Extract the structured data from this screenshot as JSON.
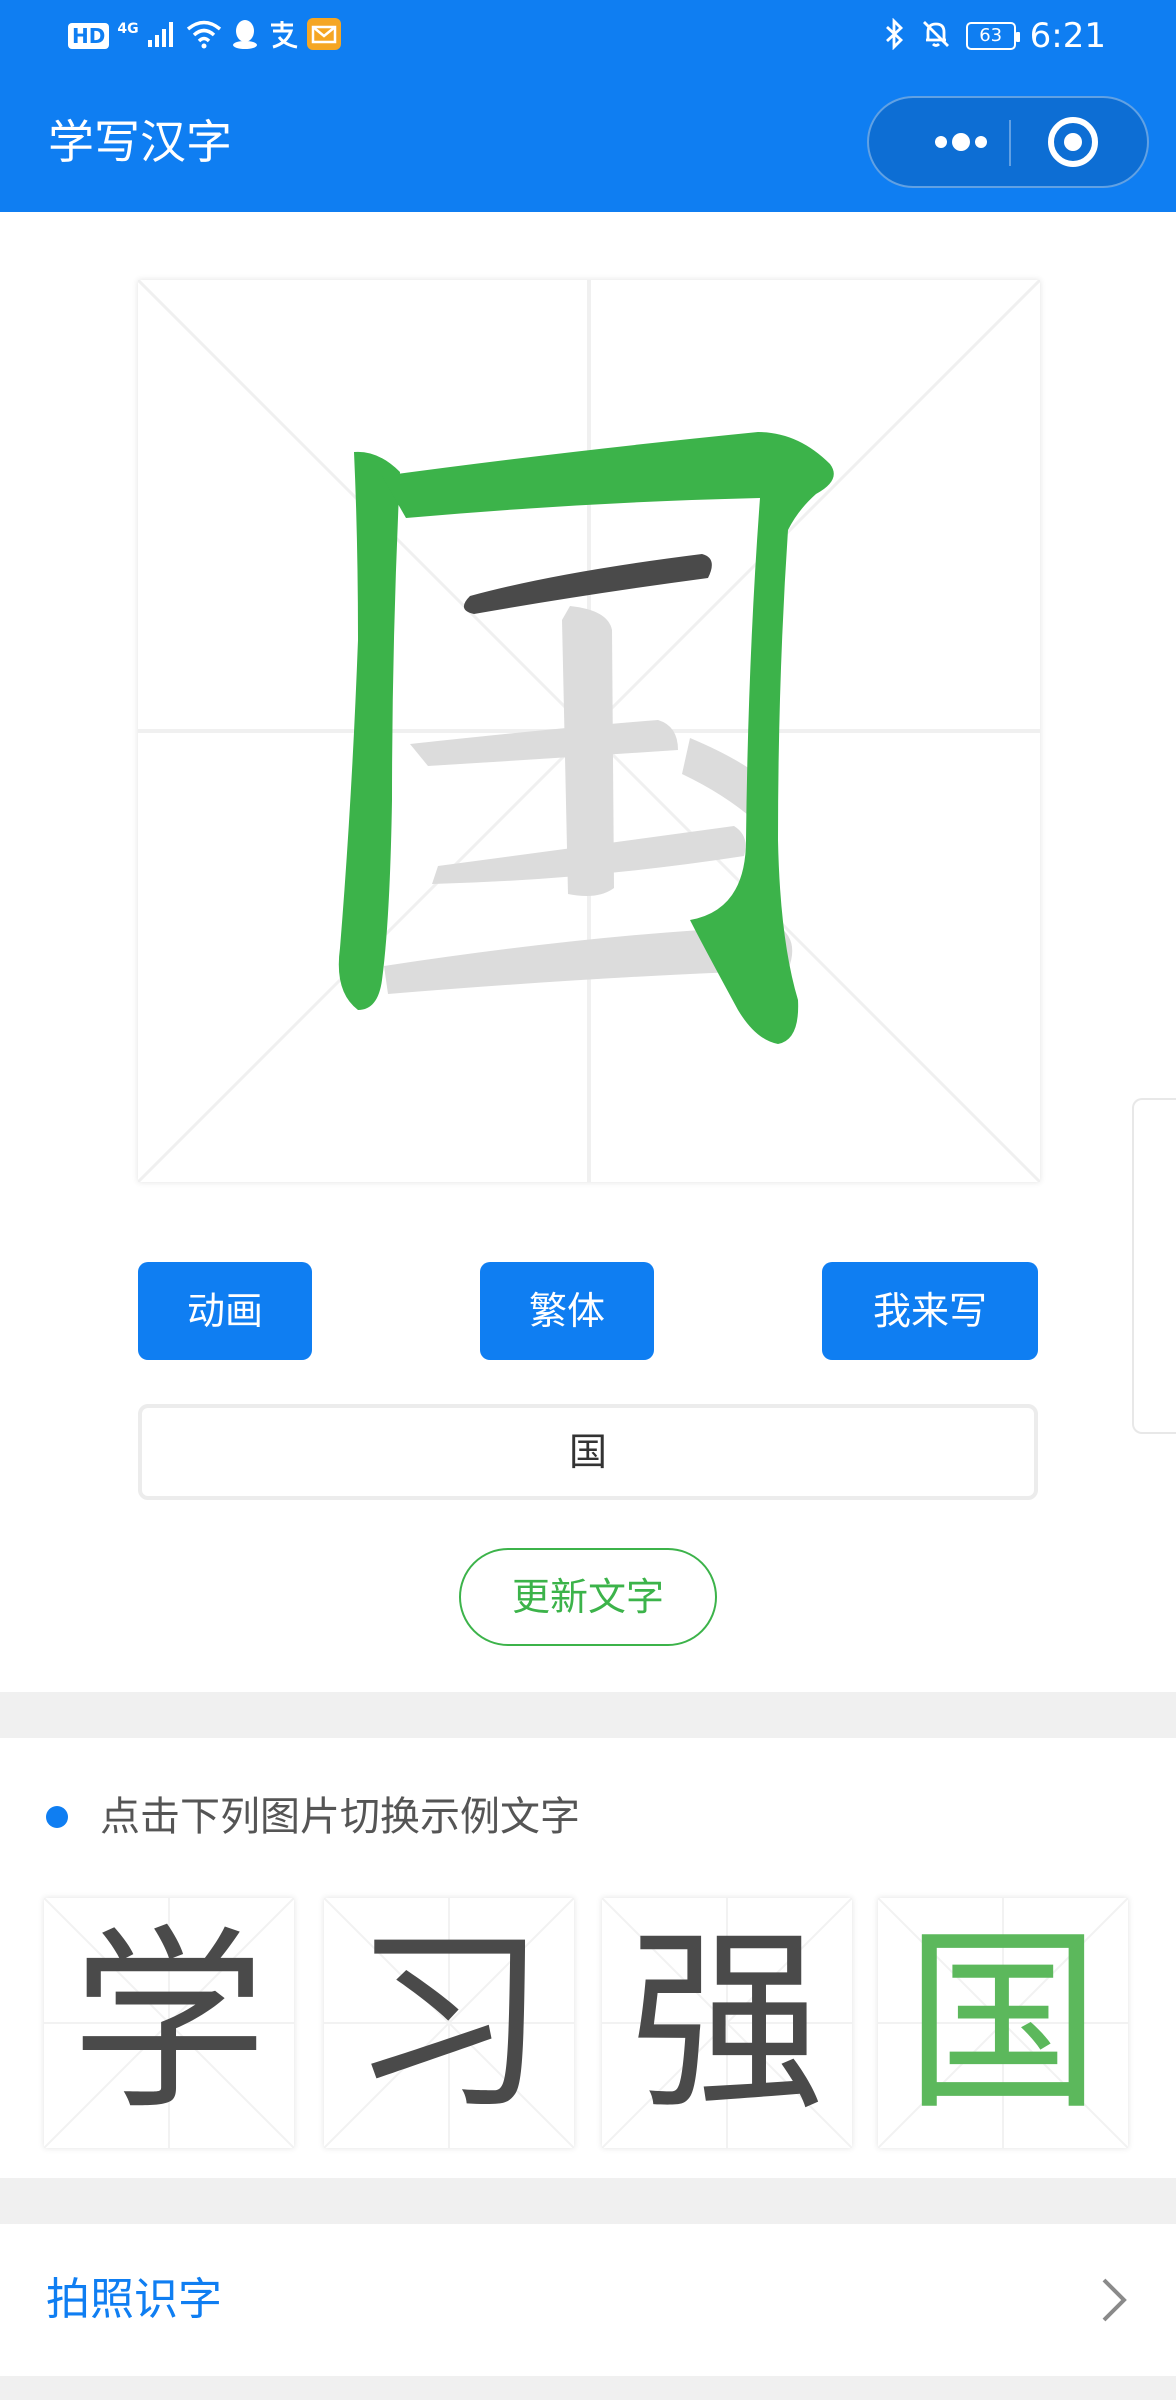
{
  "status_bar": {
    "left_hd": "HD",
    "left_network": "4G",
    "battery": "63",
    "time": "6:21"
  },
  "nav": {
    "title": "学写汉字"
  },
  "main": {
    "buttons": {
      "animate": "动画",
      "traditional": "繁体",
      "practice": "我来写"
    },
    "input_value": "国",
    "update_button": "更新文字"
  },
  "examples": {
    "tip": "点击下列图片切换示例文字",
    "chars": [
      "学",
      "习",
      "强",
      "国"
    ]
  },
  "menu": {
    "photo_recognize": "拍照识字"
  },
  "colors": {
    "primary_blue": "#0f7ef2",
    "stroke_green": "#3cb34a",
    "stroke_dark": "#4a4a4a",
    "stroke_pending": "#dcdcdc"
  },
  "icons": [
    "wifi-icon",
    "signal-icon",
    "qq-icon",
    "alipay-icon",
    "mail-icon",
    "bluetooth-icon",
    "bell-off-icon",
    "more-icon",
    "close-target-icon",
    "chevron-right-icon"
  ]
}
